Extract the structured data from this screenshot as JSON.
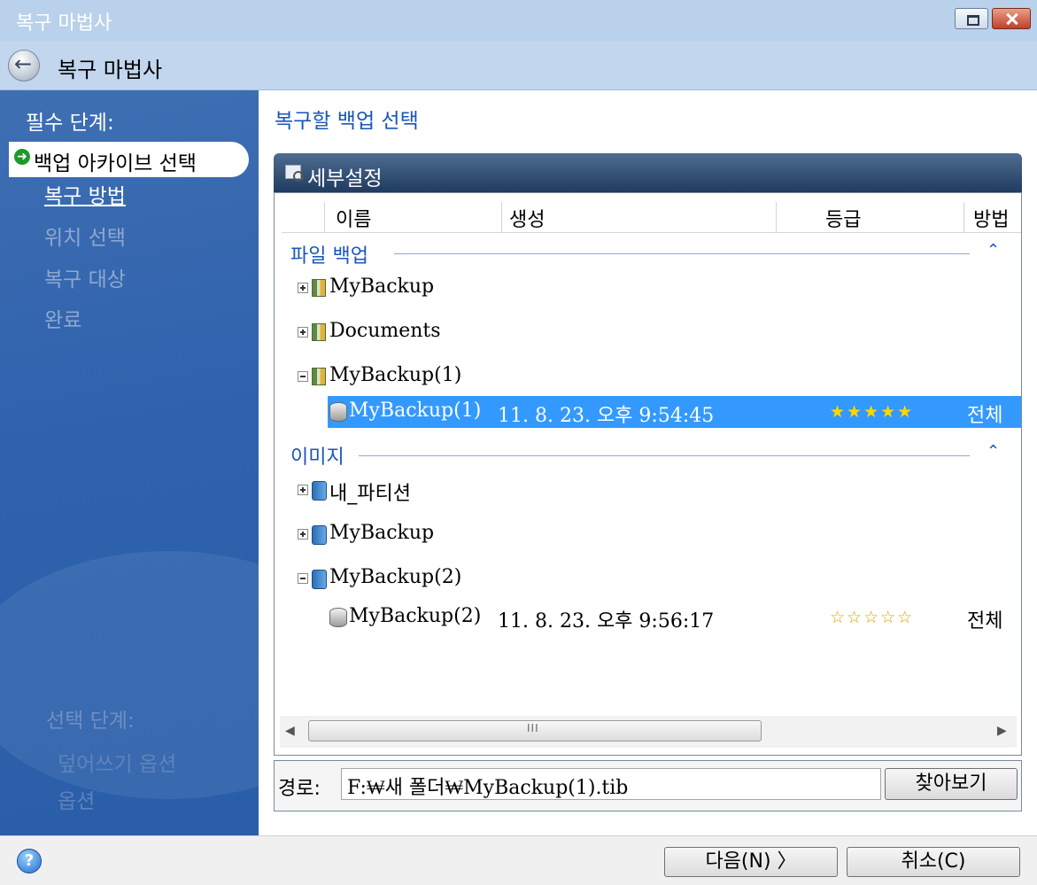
{
  "window": {
    "title": "복구 마법사"
  },
  "nav": {
    "title": "복구 마법사"
  },
  "sidebar": {
    "heading": "필수 단계:",
    "steps": [
      {
        "label": "백업 아카이브 선택",
        "state": "active"
      },
      {
        "label": "복구 방법",
        "state": "link"
      },
      {
        "label": "위치 선택",
        "state": "disabled"
      },
      {
        "label": "복구 대상",
        "state": "disabled"
      },
      {
        "label": "완료",
        "state": "disabled"
      }
    ],
    "optional_heading": "선택 단계:",
    "optional_steps": [
      {
        "label": "덮어쓰기 옵션"
      },
      {
        "label": "옵션"
      }
    ]
  },
  "main": {
    "heading": "복구할 백업 선택",
    "panel_title": "세부설정",
    "columns": [
      "이름",
      "생성",
      "등급",
      "방법"
    ],
    "groups": [
      {
        "title": "파일 백업",
        "items": [
          {
            "name": "MyBackup",
            "expanded": false
          },
          {
            "name": "Documents",
            "expanded": false
          },
          {
            "name": "MyBackup(1)",
            "expanded": true,
            "child": {
              "name": "MyBackup(1)",
              "created": "11. 8. 23. 오후 9:54:45",
              "rating": "★★★★★",
              "method": "전체",
              "selected": true
            }
          }
        ]
      },
      {
        "title": "이미지",
        "items": [
          {
            "name": "내_파티션",
            "expanded": false
          },
          {
            "name": "MyBackup",
            "expanded": false
          },
          {
            "name": "MyBackup(2)",
            "expanded": true,
            "child": {
              "name": "MyBackup(2)",
              "created": "11. 8. 23. 오후 9:56:17",
              "rating": "☆☆☆☆☆",
              "method": "전체",
              "selected": false
            }
          }
        ]
      }
    ],
    "path_label": "경로:",
    "path_value": "F:₩새 폴더₩MyBackup(1).tib",
    "browse_label": "찾아보기"
  },
  "footer": {
    "help_label": "?",
    "next_label": "다음(N) 〉",
    "cancel_label": "취소(C)"
  },
  "colors": {
    "sidebar_blue": "#2f62ae",
    "selection": "#3399ff",
    "heading_blue": "#1a56b8"
  },
  "icons": [
    "back-arrow-icon",
    "minimize-icon",
    "close-icon",
    "green-arrow-icon",
    "magnifier-icon",
    "archive-icon",
    "disk-icon",
    "database-icon",
    "help-icon"
  ]
}
